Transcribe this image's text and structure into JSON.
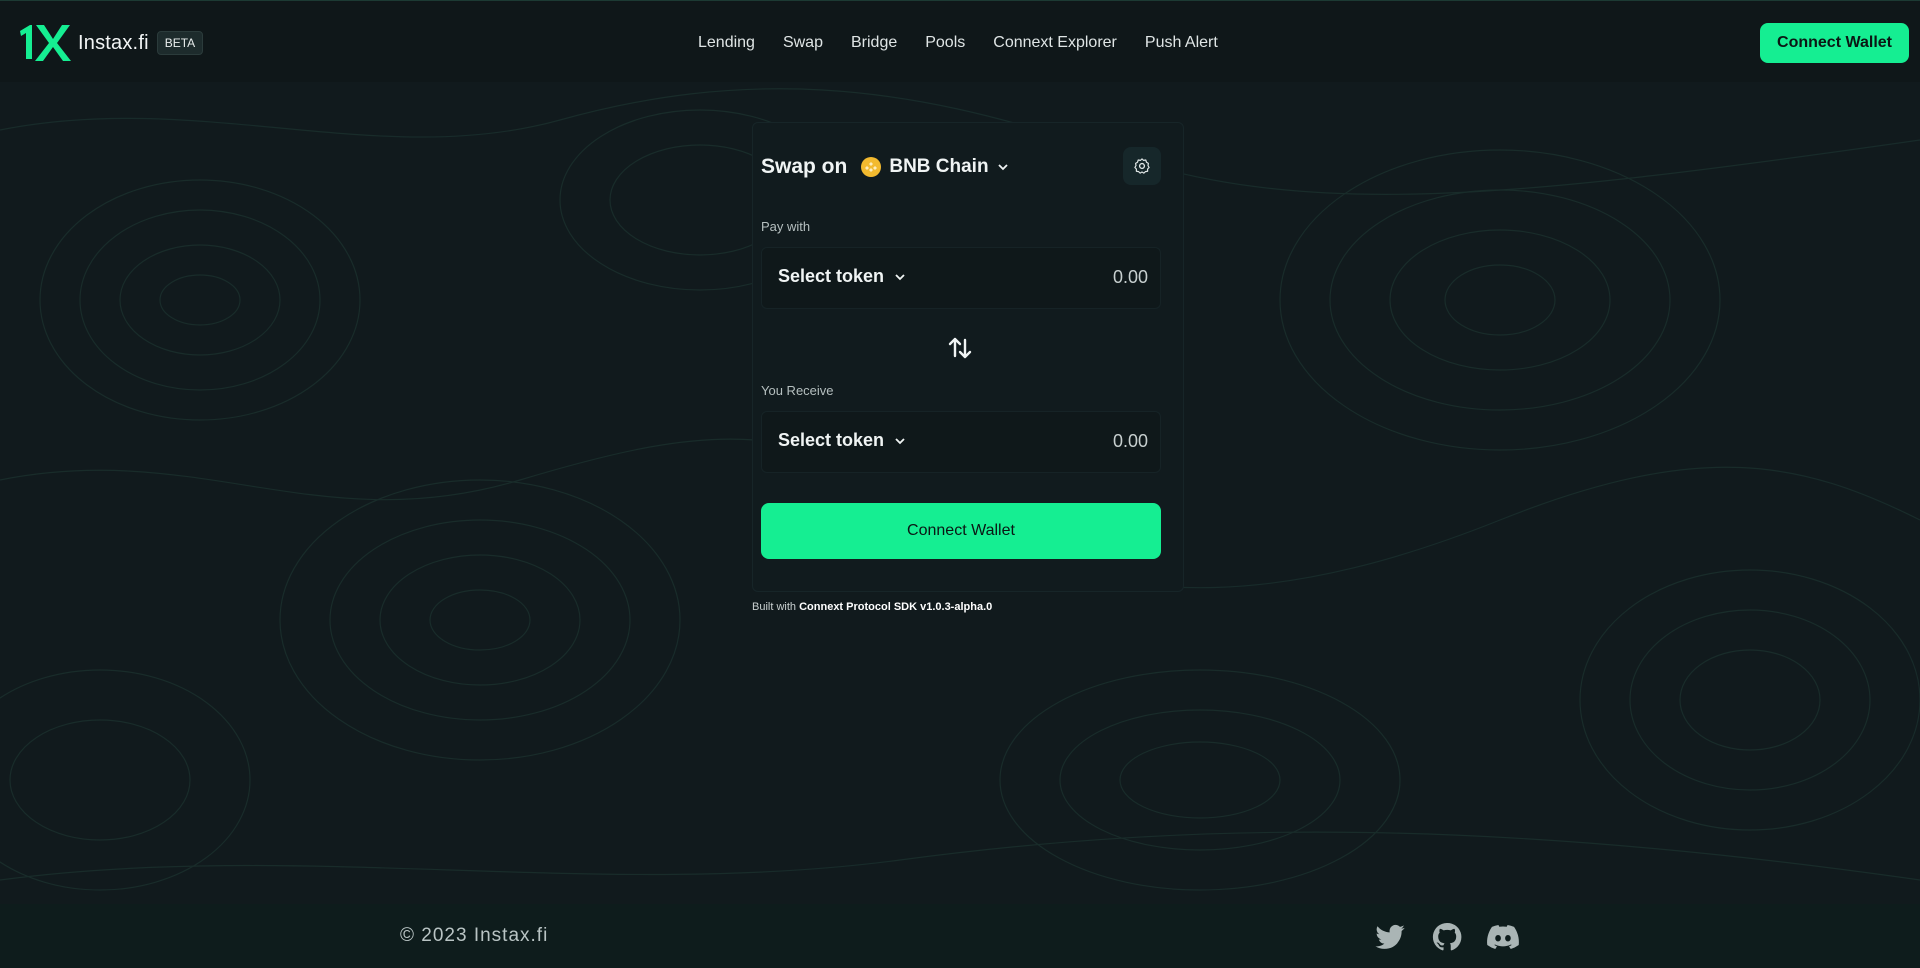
{
  "header": {
    "brand": "Instax.fi",
    "badge": "BETA",
    "nav": [
      "Lending",
      "Swap",
      "Bridge",
      "Pools",
      "Connext Explorer",
      "Push Alert"
    ],
    "connect_label": "Connect Wallet"
  },
  "swap": {
    "title": "Swap on",
    "chain": "BNB Chain",
    "pay_label": "Pay with",
    "pay_token": "Select token",
    "pay_amount": "0.00",
    "receive_label": "You Receive",
    "receive_token": "Select token",
    "receive_amount": "0.00",
    "connect_label": "Connect Wallet"
  },
  "built": {
    "prefix": "Built with",
    "sdk": "Connext Protocol SDK v1.0.3-alpha.0"
  },
  "footer": {
    "copyright": "© 2023 Instax.fi",
    "icons": [
      "twitter-icon",
      "github-icon",
      "discord-icon"
    ]
  },
  "colors": {
    "accent": "#15ee92",
    "background": "#111a1d",
    "chain_icon": "#f3ba2f"
  }
}
